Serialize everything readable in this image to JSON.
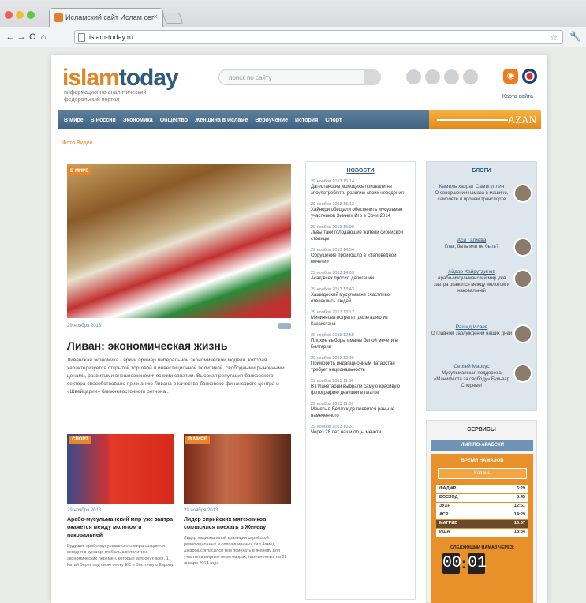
{
  "browser": {
    "tab_title": "Исламский сайт Ислам сег",
    "tab_close": "×",
    "back": "←",
    "forward": "→",
    "reload": "C",
    "home": "⌂",
    "url": "islam-today.ru",
    "star": "☆",
    "menu": "🔧"
  },
  "header": {
    "logo_a": "islam",
    "logo_b": "today",
    "tagline": "информационно-аналитический федеральный портал",
    "search_placeholder": "поиск по сайту",
    "rss": "◉",
    "sitemap": "Карта сайта"
  },
  "menu": {
    "items": [
      "В мире",
      "В России",
      "Экономика",
      "Общество",
      "Женщина в Исламе",
      "Вероучение",
      "История",
      "Спорт"
    ],
    "azan_label": "AZAN"
  },
  "breadcrumb": "Фото   Видео",
  "hero": {
    "tag": "В МИРЕ",
    "date": "29 ноября 2013",
    "title": "Ливан: экономическая жизнь",
    "lead": "Ливанская экономика - яркий пример либеральной экономической модели, которая характеризуется открытой торговой и инвестиционной политикой, свободными рыночными ценами, развитыми внешнеэкономическими связями. Высокая репутация банковского сектора способствовало признанию Ливана в качестве банковско-финансового центра и «Швейцарии» ближневосточного региона ."
  },
  "secondary": [
    {
      "tag": "СПОРТ",
      "date": "29 ноября 2013",
      "title": "Арабо-мусульманский мир уже завтра окажется между молотом и наковальней",
      "text": "Будущее арабо-мусульманского мира создается сегодня в кухнице глобальных политико-экономических перемен, которые затронут всех. 1. Китай берет под свою опеку ЕС и Восточную Европу."
    },
    {
      "tag": "В МИРЕ",
      "date": "29 ноября 2013",
      "title": "Лидер сирийских мятежников согласился поехать в Женеву",
      "text": "Лидер национальной коалиции сирийской революционных и оппозиционных сил Ахмед Джарба согласился тем приехать в Женеву для участия в мирных переговорах, назначенных на 22 января 2014 года."
    }
  ],
  "news": {
    "title": "НОВОСТИ",
    "items": [
      {
        "d": "29 ноября 2013 15:14",
        "t": "Дагестанские молодежь призвали не злоупотреблять религию своих неведения"
      },
      {
        "d": "29 ноября 2013 15:13",
        "t": "Хайнори обещали обеспечить мусульман участников Зимних Игр в Сочи-2014"
      },
      {
        "d": "29 ноября 2013 15:00",
        "t": "Львы таки голодающие жители сирийской столицы"
      },
      {
        "d": "29 ноября 2013 14:54",
        "t": "Обрушение произошло в «Заповедной мечети»"
      },
      {
        "d": "29 ноября 2013 14:09",
        "t": "Асад всех просил делегации"
      },
      {
        "d": "29 ноября 2013 13:43",
        "t": "Хашидоский мусульмане счастливо отвлеклись людей"
      },
      {
        "d": "29 ноября 2013 13:17",
        "t": "Миниянова встретил делегацию из Казахстана"
      },
      {
        "d": "29 ноября 2013 12:58",
        "t": "Плохие выборы имамы белой мечети в Болгарии"
      },
      {
        "d": "29 ноября 2013 12:16",
        "t": "Приморить индагационным Татарстан требует национальность"
      },
      {
        "d": "29 ноября 2013 11:56",
        "t": "В Планетарии выбрали самую красивую фотографию девушки в платке"
      },
      {
        "d": "29 ноября 2013 11:07",
        "t": "Мечеть в Белгороде появится раньше намеченного"
      },
      {
        "d": "29 ноября 2013 10:31",
        "t": "Через 28 лет наши отцы мечети"
      }
    ]
  },
  "blogs": {
    "title": "БЛОГИ",
    "items": [
      {
        "name": "Камиль хазрат Самигуллин",
        "text": "О совершении намаза в машине, самолете и прочем транспорте"
      },
      {
        "name": "Аси Гагиева",
        "text": "Глаз, быть или не быть?"
      },
      {
        "name": "Айдар Хайрутдинов",
        "text": "Арабо-мусульманский мир уже завтра окажется между молотом и наковальней"
      },
      {
        "name": "Рашид Исаев",
        "text": "О главном заблуждении наших дней"
      },
      {
        "name": "Сергей Маркус",
        "text": "Мусульманская поддержка «Манифеста за свободу» Бульвар Спорные!"
      }
    ]
  },
  "services": {
    "title": "СЕРВИСЫ",
    "arabic": "ИМЯ ПО-АРАБСКИ",
    "prayer_title": "ВРЕМЯ НАМАЗОВ",
    "city": "Казань",
    "times": [
      {
        "n": "ФАДЖР",
        "t": "6:29"
      },
      {
        "n": "ВОСХОД",
        "t": "8:45"
      },
      {
        "n": "ЗУХР",
        "t": "12:51"
      },
      {
        "n": "АСР",
        "t": "14:29"
      },
      {
        "n": "МАГРИБ",
        "t": "16:57"
      },
      {
        "n": "ИША",
        "t": "18:34"
      }
    ],
    "next_label": "СЛЕДУЮЩИЙ НАМАЗ ЧЕРЕЗ:",
    "cd_h": "00",
    "cd_m": "01"
  }
}
